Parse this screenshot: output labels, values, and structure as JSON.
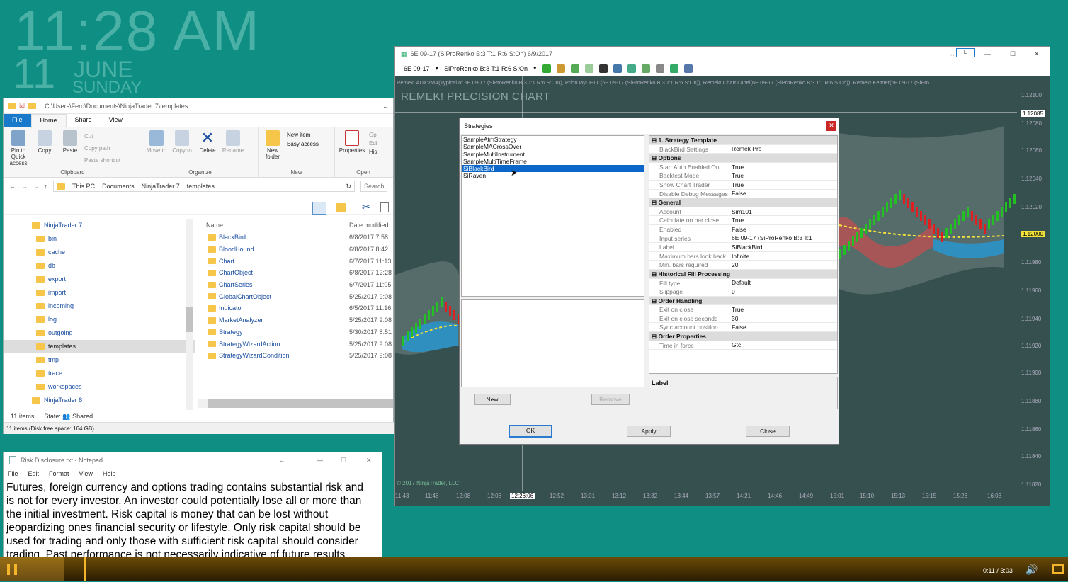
{
  "clock": {
    "time": "11:28 AM",
    "day": "11",
    "month": "JUNE",
    "weekday": "SUNDAY"
  },
  "explorer": {
    "title": "C:\\Users\\Fero\\Documents\\NinjaTrader 7\\templates",
    "tabs": [
      "File",
      "Home",
      "Share",
      "View"
    ],
    "clipboard": {
      "pin": "Pin to Quick access",
      "copy": "Copy",
      "paste": "Paste",
      "cut": "Cut",
      "copy_path": "Copy path",
      "paste_shortcut": "Paste shortcut",
      "group": "Clipboard"
    },
    "organize": {
      "move": "Move to",
      "copy": "Copy to",
      "delete": "Delete",
      "rename": "Rename",
      "group": "Organize"
    },
    "new": {
      "new_folder": "New folder",
      "new_item": "New item",
      "easy_access": "Easy access",
      "group": "New"
    },
    "open": {
      "properties": "Properties",
      "group": "Open",
      "op": "Op",
      "edi": "Edi",
      "his": "His"
    },
    "breadcrumb": [
      "This PC",
      "Documents",
      "NinjaTrader 7",
      "templates"
    ],
    "search": "Search",
    "tree": [
      "NinjaTrader 7",
      "bin",
      "cache",
      "db",
      "export",
      "import",
      "incoming",
      "log",
      "outgoing",
      "templates",
      "tmp",
      "trace",
      "workspaces",
      "NinjaTrader 8"
    ],
    "columns": {
      "name": "Name",
      "date": "Date modified"
    },
    "files": [
      {
        "name": "BlackBird",
        "date": "6/8/2017 7:58"
      },
      {
        "name": "BloodHound",
        "date": "6/8/2017 8:42"
      },
      {
        "name": "Chart",
        "date": "6/7/2017 11:13"
      },
      {
        "name": "ChartObject",
        "date": "6/8/2017 12:28"
      },
      {
        "name": "ChartSeries",
        "date": "6/7/2017 11:05"
      },
      {
        "name": "GlobalChartObject",
        "date": "5/25/2017 9:08"
      },
      {
        "name": "Indicator",
        "date": "6/5/2017 11:16"
      },
      {
        "name": "MarketAnalyzer",
        "date": "5/25/2017 9:08"
      },
      {
        "name": "Strategy",
        "date": "5/30/2017 8:51"
      },
      {
        "name": "StrategyWizardAction",
        "date": "5/25/2017 9:08"
      },
      {
        "name": "StrategyWizardCondition",
        "date": "5/25/2017 9:08"
      }
    ],
    "status_items": "11 items",
    "status_state": "State:",
    "status_shared": "Shared",
    "footer": "11 items (Disk free space: 164 GB)"
  },
  "notepad": {
    "title": "Risk Disclosure.txt - Notepad",
    "menu": [
      "File",
      "Edit",
      "Format",
      "View",
      "Help"
    ],
    "text": "Futures, foreign currency and options trading contains substantial risk and is not for every investor. An investor could potentially lose all or more than the initial investment. Risk capital is money that can be lost without jeopardizing ones financial security or lifestyle. Only risk capital should be used for trading and only those with sufficient risk capital should consider trading. Past performance is not necessarily indicative of future results."
  },
  "chart": {
    "title": "6E 09-17 (SiProRenko B:3 T:1 R:6 S:On)  6/9/2017",
    "instrument": "6E 09-17",
    "series": "SiProRenko B:3 T:1 R:6 S:On",
    "l_button": "L",
    "indicators": "Remek! ADXVMA(Typical of 6E 09-17 (SiProRenko B:3 T:1 R:6 S:On)), PriorDayOHLC(6E 09-17 (SiProRenko B:3 T:1 R:6 S:On)), Remek! Chart Label(6E 09-17 (SiProRenko B:3 T:1 R:6 S:On)), Remek! Keltner(6E 09-17 (SiPro",
    "heading": "REMEK! PRECISION CHART",
    "copyright": "© 2017 NinjaTrader, LLC",
    "y_labels": [
      "1.12100",
      "1.12085",
      "1.12080",
      "1.12060",
      "1.12040",
      "1.12020",
      "1.12000",
      "1.11980",
      "1.11960",
      "1.11940",
      "1.11920",
      "1.11900",
      "1.11880",
      "1.11860",
      "1.11840",
      "1.11820"
    ],
    "x_labels": [
      "11:43",
      "11:48",
      "12:08",
      "12:08",
      "12:26:06",
      "12:52",
      "13:01",
      "13:12",
      "13:32",
      "13:44",
      "13:57",
      "14:21",
      "14:46",
      "14:49",
      "15:01",
      "15:10",
      "15:13",
      "15:15",
      "15:26",
      "16:03"
    ],
    "colors": {
      "up": "#22c022",
      "down": "#e02020",
      "bg": "#36504f",
      "band": "#5e7473"
    }
  },
  "strategies": {
    "title": "Strategies",
    "list": [
      "SampleAtmStrategy",
      "SampleMACrossOver",
      "SampleMultiInstrument",
      "SampleMultiTimeFrame",
      "SiBlackBird",
      "SiRaven"
    ],
    "selected": "SiBlackBird",
    "buttons": {
      "new": "New",
      "remove": "Remove",
      "ok": "OK",
      "apply": "Apply",
      "close": "Close"
    },
    "properties": [
      {
        "cat": "1. Strategy Template"
      },
      {
        "k": "BlackBird Settings",
        "v": "Remek Pro"
      },
      {
        "cat": "Options"
      },
      {
        "k": "Start Auto Enabled On",
        "v": "True"
      },
      {
        "k": "Backtest Mode",
        "v": "True"
      },
      {
        "k": "Show Chart Trader",
        "v": "True"
      },
      {
        "k": "Disable Debug Messages",
        "v": "False"
      },
      {
        "cat": "General"
      },
      {
        "k": "Account",
        "v": "Sim101"
      },
      {
        "k": "Calculate on bar close",
        "v": "True"
      },
      {
        "k": "Enabled",
        "v": "False"
      },
      {
        "k": "Input series",
        "v": "6E 09-17 (SiProRenko B:3 T:1"
      },
      {
        "k": "Label",
        "v": "SiBlackBird"
      },
      {
        "k": "Maximum bars look back",
        "v": "Infinite"
      },
      {
        "k": "Min. bars required",
        "v": "20"
      },
      {
        "cat": "Historical Fill Processing"
      },
      {
        "k": "Fill type",
        "v": "Default"
      },
      {
        "k": "Slippage",
        "v": "0"
      },
      {
        "cat": "Order Handling"
      },
      {
        "k": "Exit on close",
        "v": "True"
      },
      {
        "k": "Exit on close seconds",
        "v": "30"
      },
      {
        "k": "Sync account position",
        "v": "False"
      },
      {
        "cat": "Order Properties"
      },
      {
        "k": "Time in force",
        "v": "Gtc"
      }
    ],
    "label_box": "Label"
  },
  "video": {
    "time": "0:11 / 3:03",
    "progress": 0.06
  }
}
